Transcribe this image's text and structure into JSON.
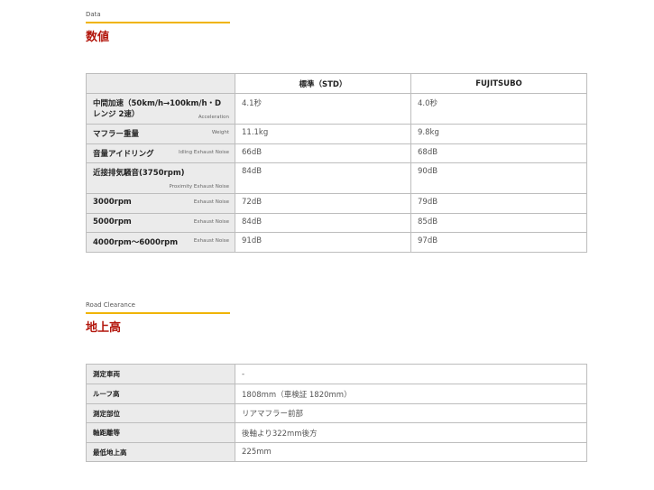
{
  "data_section": {
    "eyebrow": "Data",
    "title": "数値",
    "table": {
      "headers": [
        "",
        "標準（STD）",
        "FUJITSUBO"
      ],
      "rows": [
        {
          "label": "中間加速（50km/h→100km/h・Dレンジ 2速）",
          "sub": "Acceleration",
          "std": "4.1秒",
          "fujitsubo": "4.0秒"
        },
        {
          "label": "マフラー重量",
          "sub": "Weight",
          "std": "11.1kg",
          "fujitsubo": "9.8kg"
        },
        {
          "label": "音量アイドリング",
          "sub": "Idling Exhaust Noise",
          "std": "66dB",
          "fujitsubo": "68dB"
        },
        {
          "label": "近接排気騒音(3750rpm)",
          "sub": "Proximity Exhaust Noise",
          "std": "84dB",
          "fujitsubo": "90dB"
        },
        {
          "label": "3000rpm",
          "sub": "Exhaust Noise",
          "std": "72dB",
          "fujitsubo": "79dB"
        },
        {
          "label": "5000rpm",
          "sub": "Exhaust Noise",
          "std": "84dB",
          "fujitsubo": "85dB"
        },
        {
          "label": "4000rpm〜6000rpm",
          "sub": "Exhaust Noise",
          "std": "91dB",
          "fujitsubo": "97dB"
        }
      ]
    }
  },
  "clearance_section": {
    "eyebrow": "Road Clearance",
    "title": "地上高",
    "table": {
      "rows": [
        {
          "label": "測定車両",
          "value": "-"
        },
        {
          "label": "ルーフ高",
          "value": "1808mm（車検証 1820mm）"
        },
        {
          "label": "測定部位",
          "value": "リアマフラー前部"
        },
        {
          "label": "軸距離等",
          "value": "後軸より322mm後方"
        },
        {
          "label": "最低地上高",
          "value": "225mm"
        }
      ]
    }
  },
  "colors": {
    "accent_rule": "#f0b400",
    "heading_red": "#b3160c",
    "label_bg": "#ebebeb",
    "border": "#bdbdbd"
  }
}
